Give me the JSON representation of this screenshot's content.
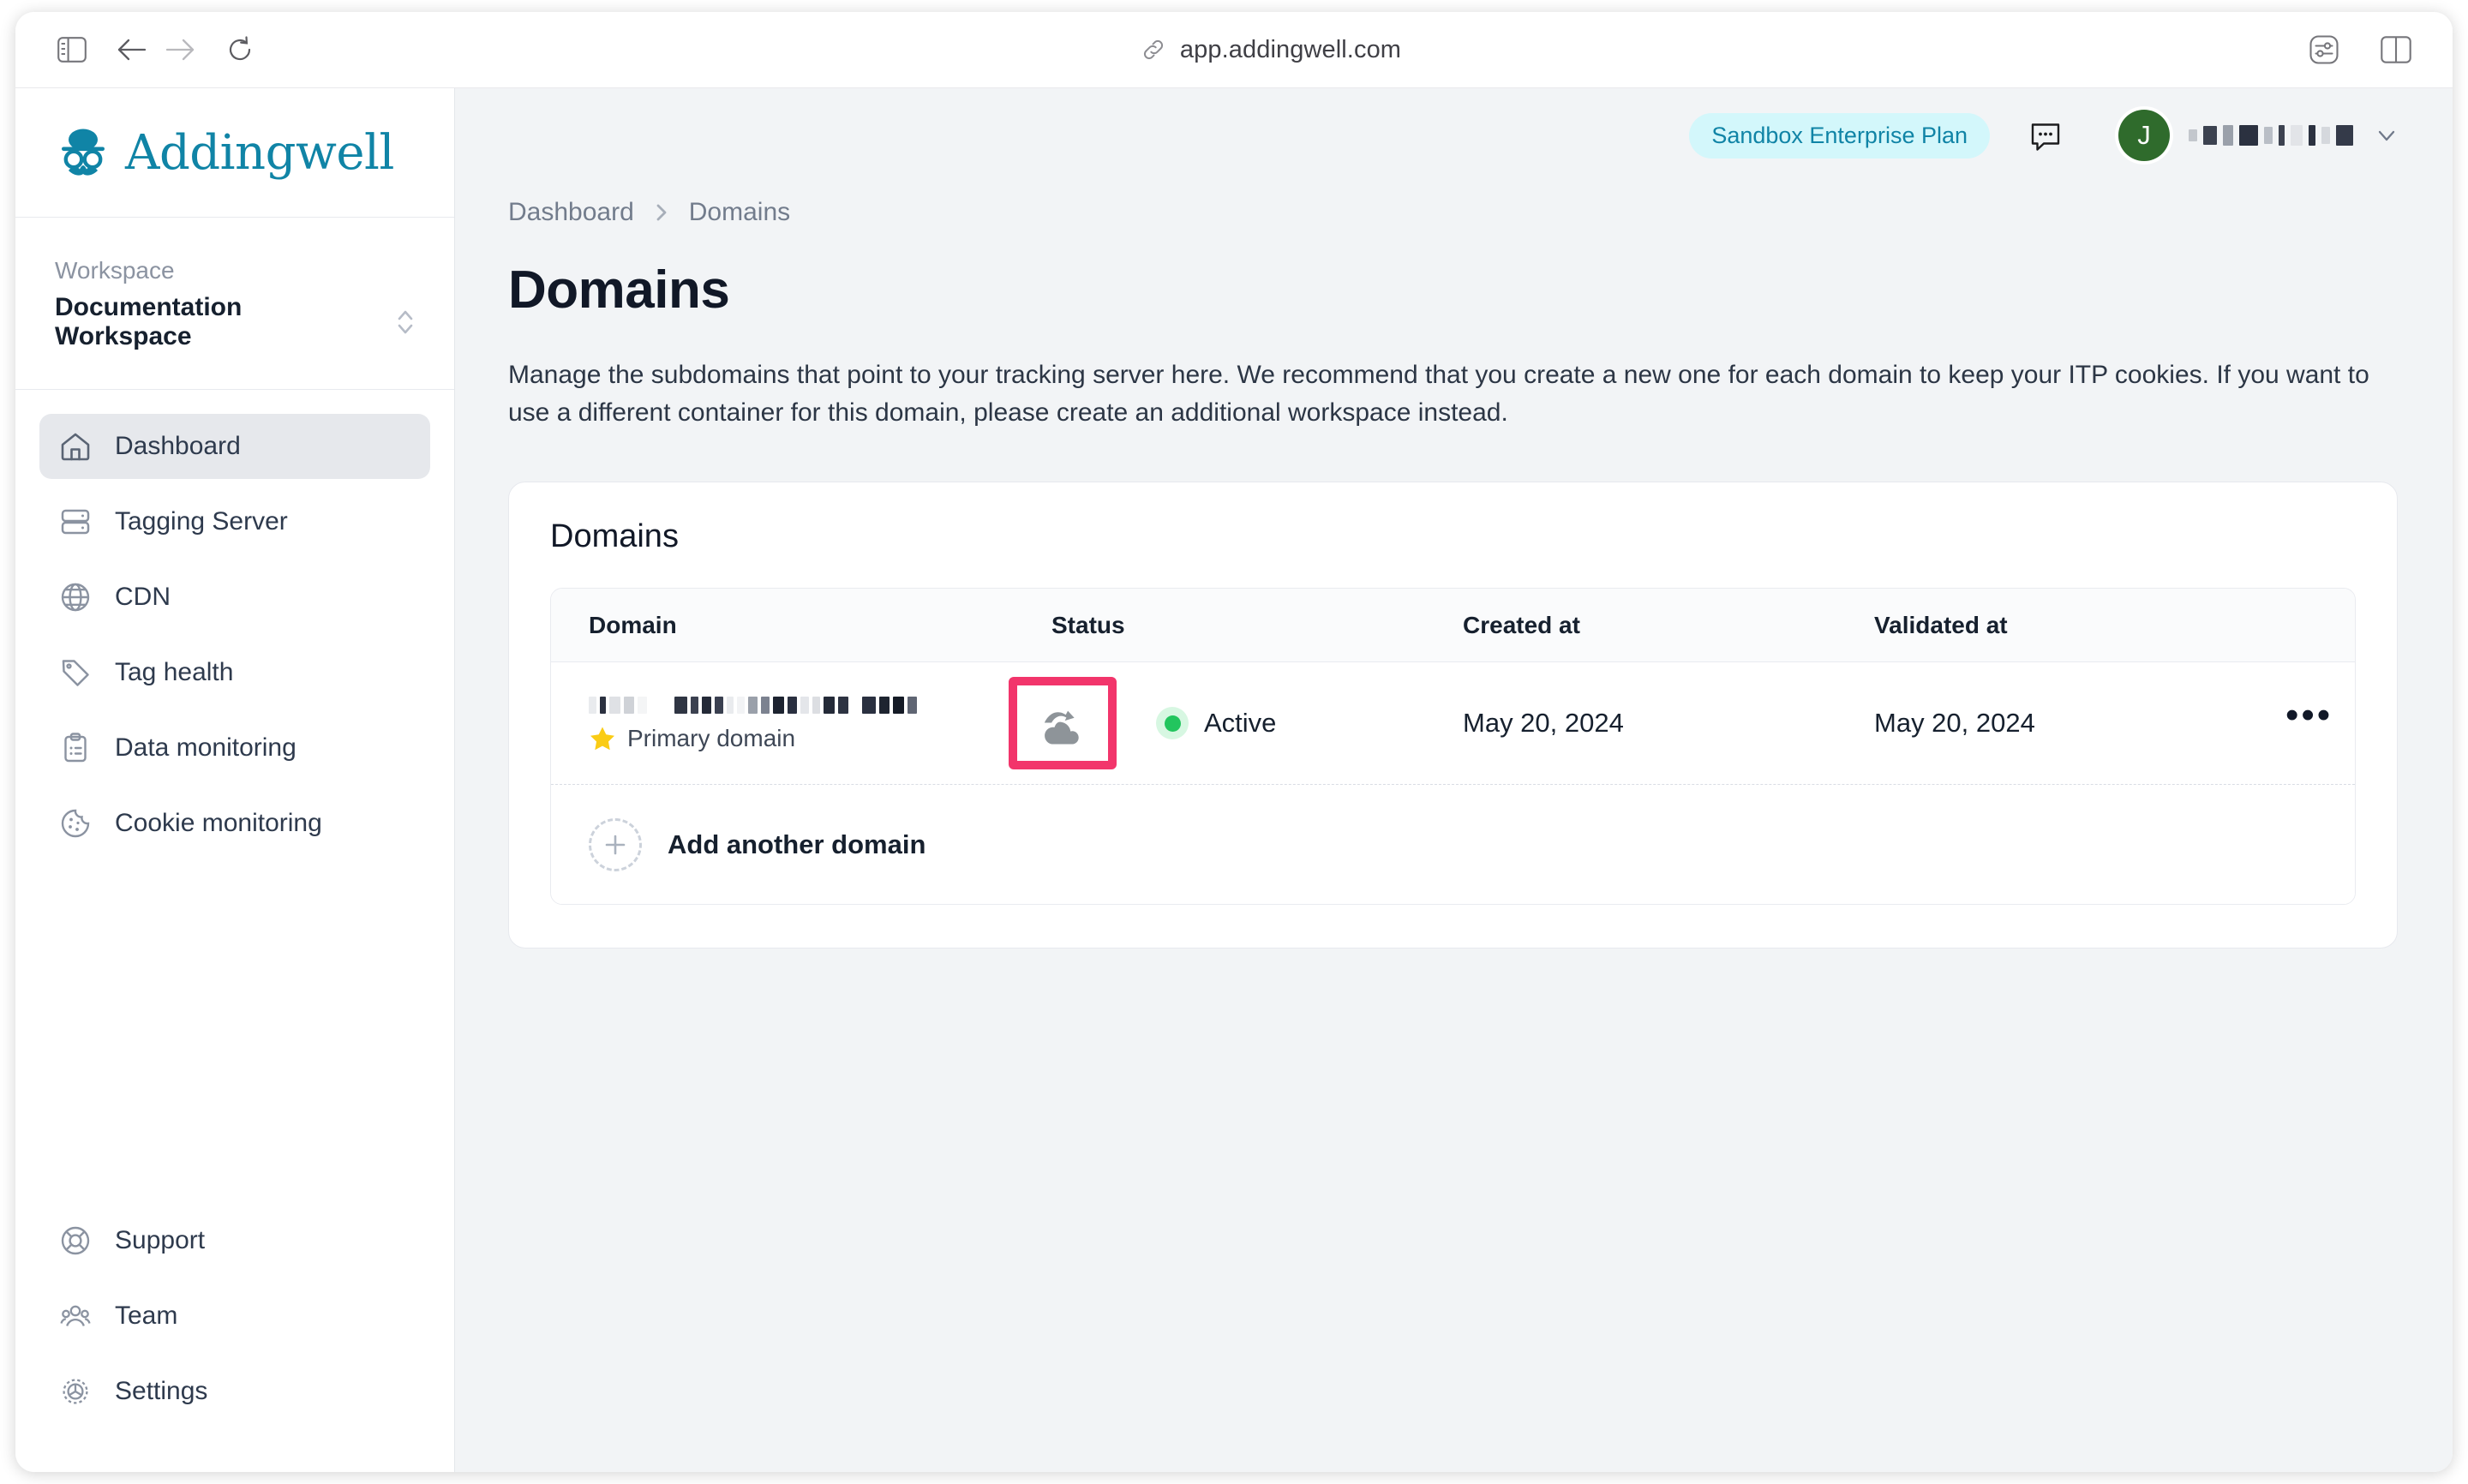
{
  "browser": {
    "url": "app.addingwell.com",
    "icons": {
      "sidebar_toggle": "sidebar-toggle-icon",
      "back": "back-arrow-icon",
      "forward": "forward-arrow-icon",
      "reload": "reload-icon",
      "link": "link-icon",
      "reader_settings": "page-settings-icon",
      "split_view": "split-view-icon"
    }
  },
  "sidebar": {
    "brand": "Addingwell",
    "workspace_label": "Workspace",
    "workspace_name": "Documentation Workspace",
    "items": [
      {
        "label": "Dashboard",
        "icon": "home-icon",
        "active": true
      },
      {
        "label": "Tagging Server",
        "icon": "server-icon",
        "active": false
      },
      {
        "label": "CDN",
        "icon": "globe-icon",
        "active": false
      },
      {
        "label": "Tag health",
        "icon": "tag-icon",
        "active": false
      },
      {
        "label": "Data monitoring",
        "icon": "clipboard-icon",
        "active": false
      },
      {
        "label": "Cookie monitoring",
        "icon": "cookie-icon",
        "active": false
      }
    ],
    "bottom_items": [
      {
        "label": "Support",
        "icon": "lifebuoy-icon"
      },
      {
        "label": "Team",
        "icon": "users-icon"
      },
      {
        "label": "Settings",
        "icon": "gear-icon"
      }
    ]
  },
  "topbar": {
    "plan_badge": "Sandbox Enterprise Plan",
    "chat_icon": "chat-bubble-icon",
    "avatar_initial": "J",
    "user_name_redacted": "",
    "caret_icon": "chevron-down-icon"
  },
  "breadcrumb": {
    "items": [
      "Dashboard",
      "Domains"
    ],
    "separator": "›"
  },
  "page": {
    "title": "Domains",
    "description": "Manage the subdomains that point to your tracking server here. We recommend that you create a new one for each domain to keep your ITP cookies. If you want to use a different container for this domain, please create an additional workspace instead."
  },
  "card": {
    "title": "Domains",
    "columns": [
      "Domain",
      "Status",
      "Created at",
      "Validated at"
    ],
    "rows": [
      {
        "domain_redacted": "",
        "primary_label": "Primary domain",
        "primary_star_icon": "star-icon",
        "cloud_icon": "cloud-upload-icon",
        "status": "Active",
        "created_at": "May 20, 2024",
        "validated_at": "May 20, 2024",
        "actions_icon": "kebab-menu-icon"
      }
    ],
    "add_row_label": "Add another domain",
    "add_row_icon": "plus-circle-icon"
  },
  "colors": {
    "brand": "#1084a6",
    "badge_bg": "#d3f7fb",
    "status_green": "#22c55e",
    "highlight_pink": "#f2356b",
    "avatar_green": "#2f6b2c",
    "star_yellow": "#facc15"
  }
}
